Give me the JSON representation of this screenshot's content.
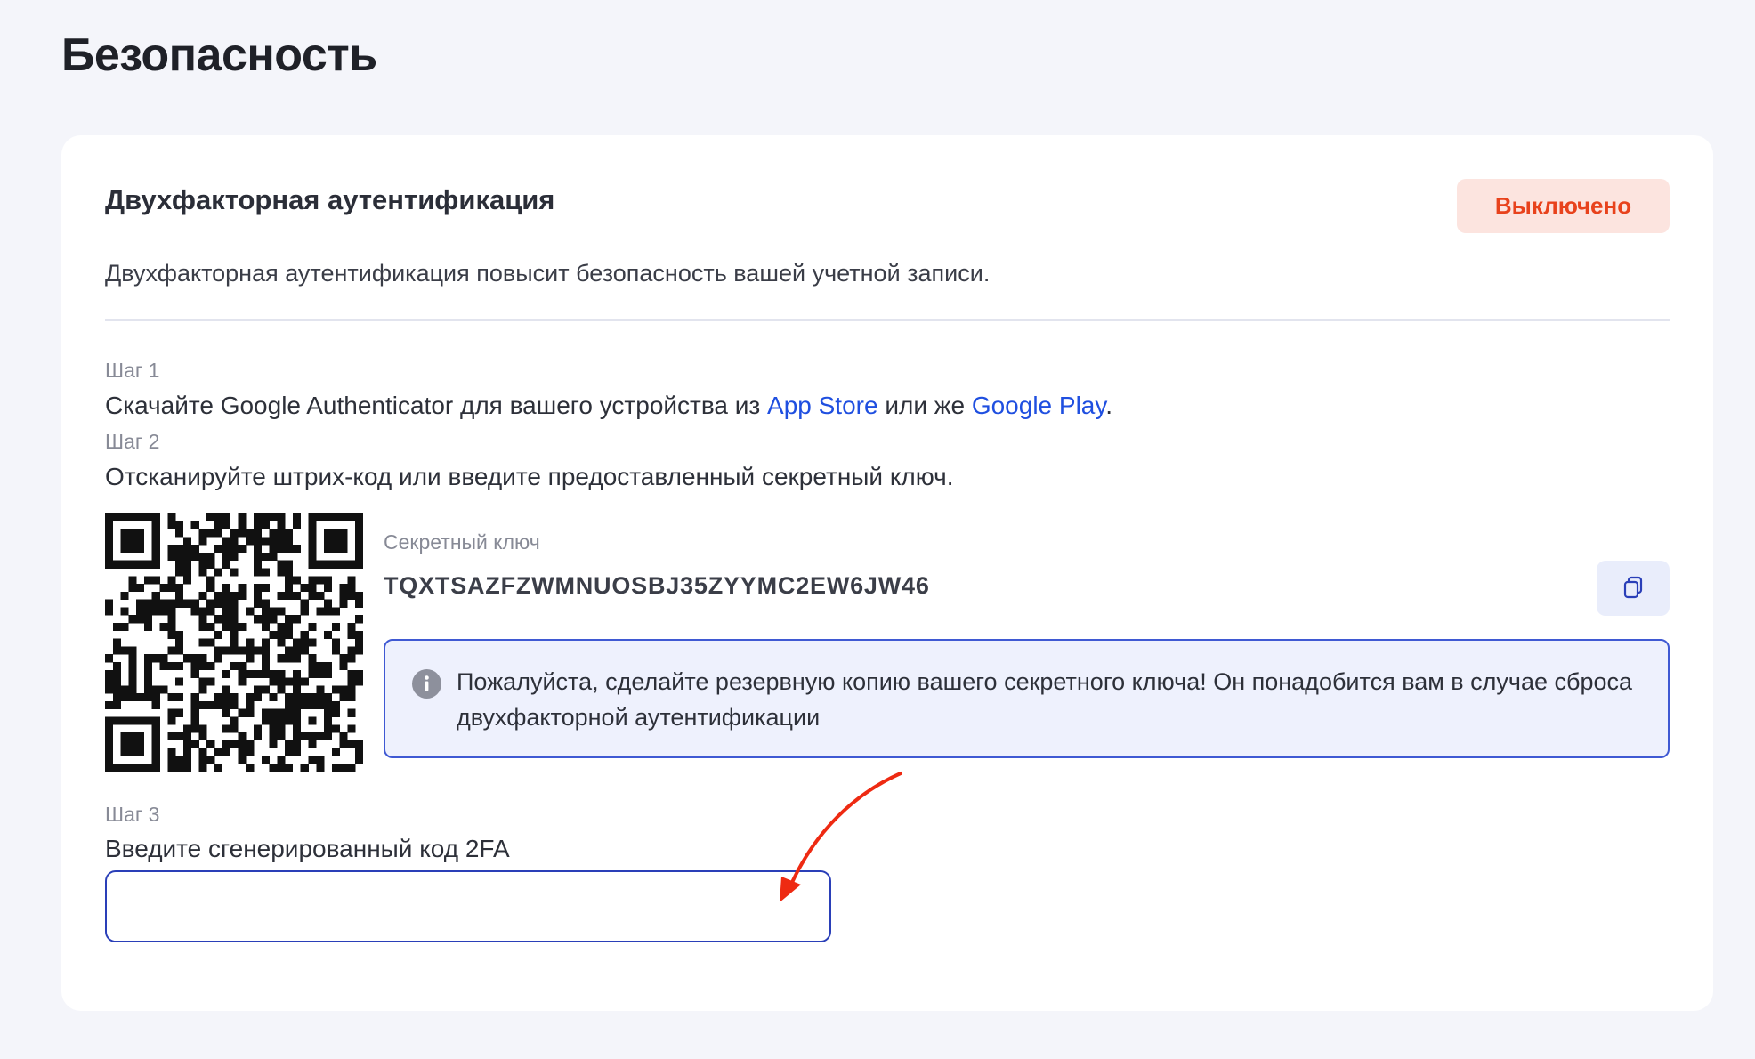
{
  "page": {
    "title": "Безопасность"
  },
  "two_factor": {
    "title": "Двухфакторная аутентификация",
    "status": "Выключено",
    "description": "Двухфакторная аутентификация повысит безопасность вашей учетной записи.",
    "step1": {
      "label": "Шаг 1",
      "text_before": "Скачайте Google Authenticator для вашего устройства из ",
      "link_app_store": "App Store",
      "text_middle": " или же ",
      "link_google_play": "Google Play",
      "text_after": "."
    },
    "step2": {
      "label": "Шаг 2",
      "text": "Отсканируйте штрих-код или введите предоставленный секретный ключ."
    },
    "secret": {
      "label": "Секретный ключ",
      "value": "TQXTSAZFZWMNUOSBJ35ZYYMC2EW6JW46"
    },
    "info": {
      "text": "Пожалуйста, сделайте резервную копию вашего секретного ключа! Он понадобится вам в случае сброса двухфакторной аутентификации"
    },
    "step3": {
      "label": "Шаг 3",
      "text": "Введите сгенерированный код 2FA",
      "input_value": "",
      "input_placeholder": ""
    }
  },
  "icons": {
    "copy": "copy-icon",
    "info": "info-icon",
    "qr": "qr-code"
  },
  "colors": {
    "status_text": "#e8421c",
    "status_bg": "#fce4df",
    "link": "#1f4fe0",
    "info_border": "#3f59d3",
    "info_bg": "#eef1fd",
    "input_border": "#2a3fb8",
    "annotation_arrow": "#ee2a12"
  }
}
